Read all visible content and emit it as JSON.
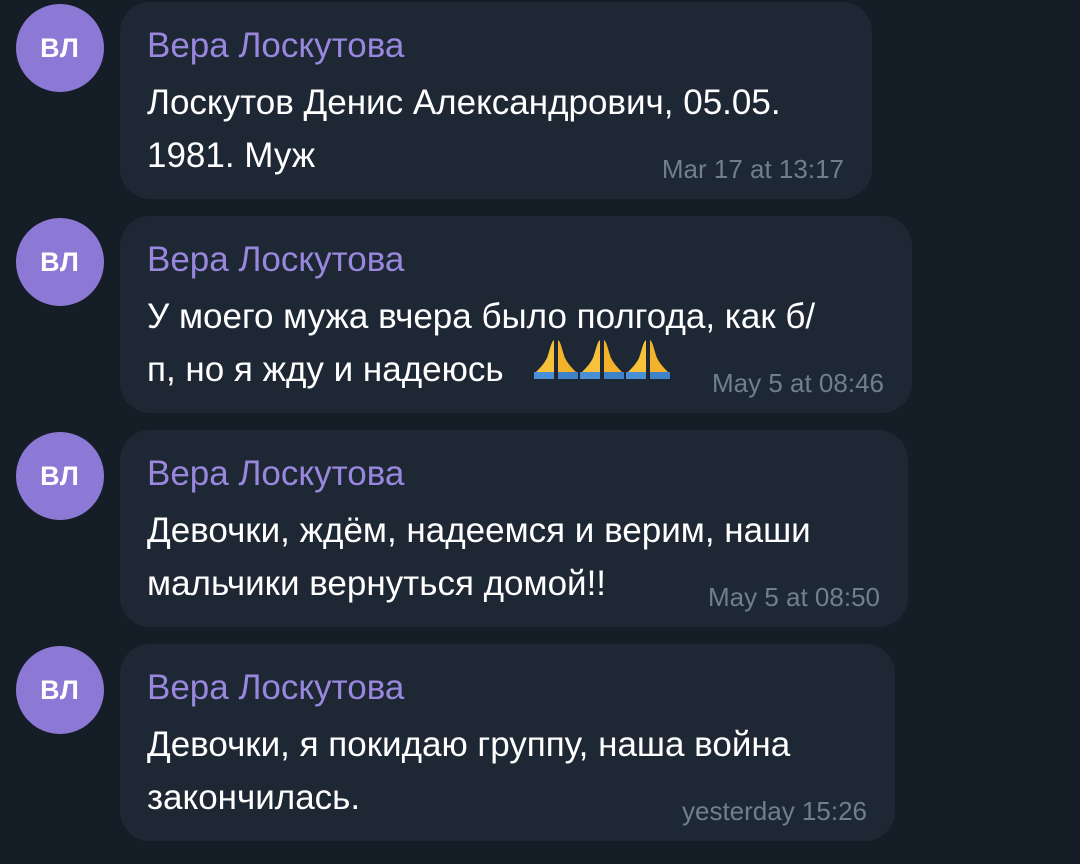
{
  "messages": [
    {
      "avatar_initials": "ВЛ",
      "sender": "Вера Лоскутова",
      "text": "Лоскутов Денис Александрович, 05.05.\n1981. Муж",
      "time": "Mar 17 at 13:17"
    },
    {
      "avatar_initials": "ВЛ",
      "sender": "Вера Лоскутова",
      "text": "У моего мужа вчера было полгода, как б/\nп, но я жду и надеюсь",
      "emoji": "pray-icon",
      "time": "May 5 at 08:46"
    },
    {
      "avatar_initials": "ВЛ",
      "sender": "Вера Лоскутова",
      "text": "Девочки, ждём, надеемся и верим, наши\nмальчики вернуться домой!!",
      "time": "May 5 at 08:50"
    },
    {
      "avatar_initials": "ВЛ",
      "sender": "Вера Лоскутова",
      "text": "Девочки, я покидаю группу, наша война\nзакончилась.",
      "time": "yesterday 15:26"
    }
  ],
  "colors": {
    "background": "#151e27",
    "bubble": "#1e2834",
    "avatar": "#8c79d6",
    "sender": "#9987de",
    "text": "#ffffff",
    "time": "#6f7f8f"
  }
}
